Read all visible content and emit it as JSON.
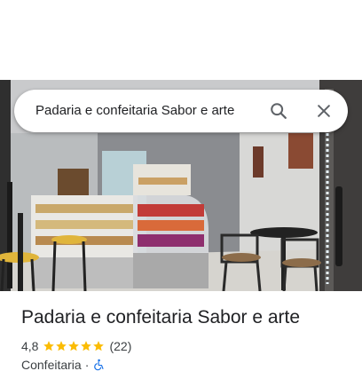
{
  "search": {
    "query": "Padaria e confeitaria Sabor e arte"
  },
  "place": {
    "title": "Padaria e confeitaria Sabor e arte",
    "rating": "4,8",
    "stars": 5,
    "review_count": "(22)",
    "category": "Confeitaria",
    "separator": "·"
  },
  "colors": {
    "star": "#fbbc04",
    "accessibility_icon": "#1a73e8",
    "icon_gray": "#5f6368"
  },
  "icons": {
    "search": "search-icon",
    "close": "close-icon",
    "accessibility": "wheelchair-icon"
  }
}
